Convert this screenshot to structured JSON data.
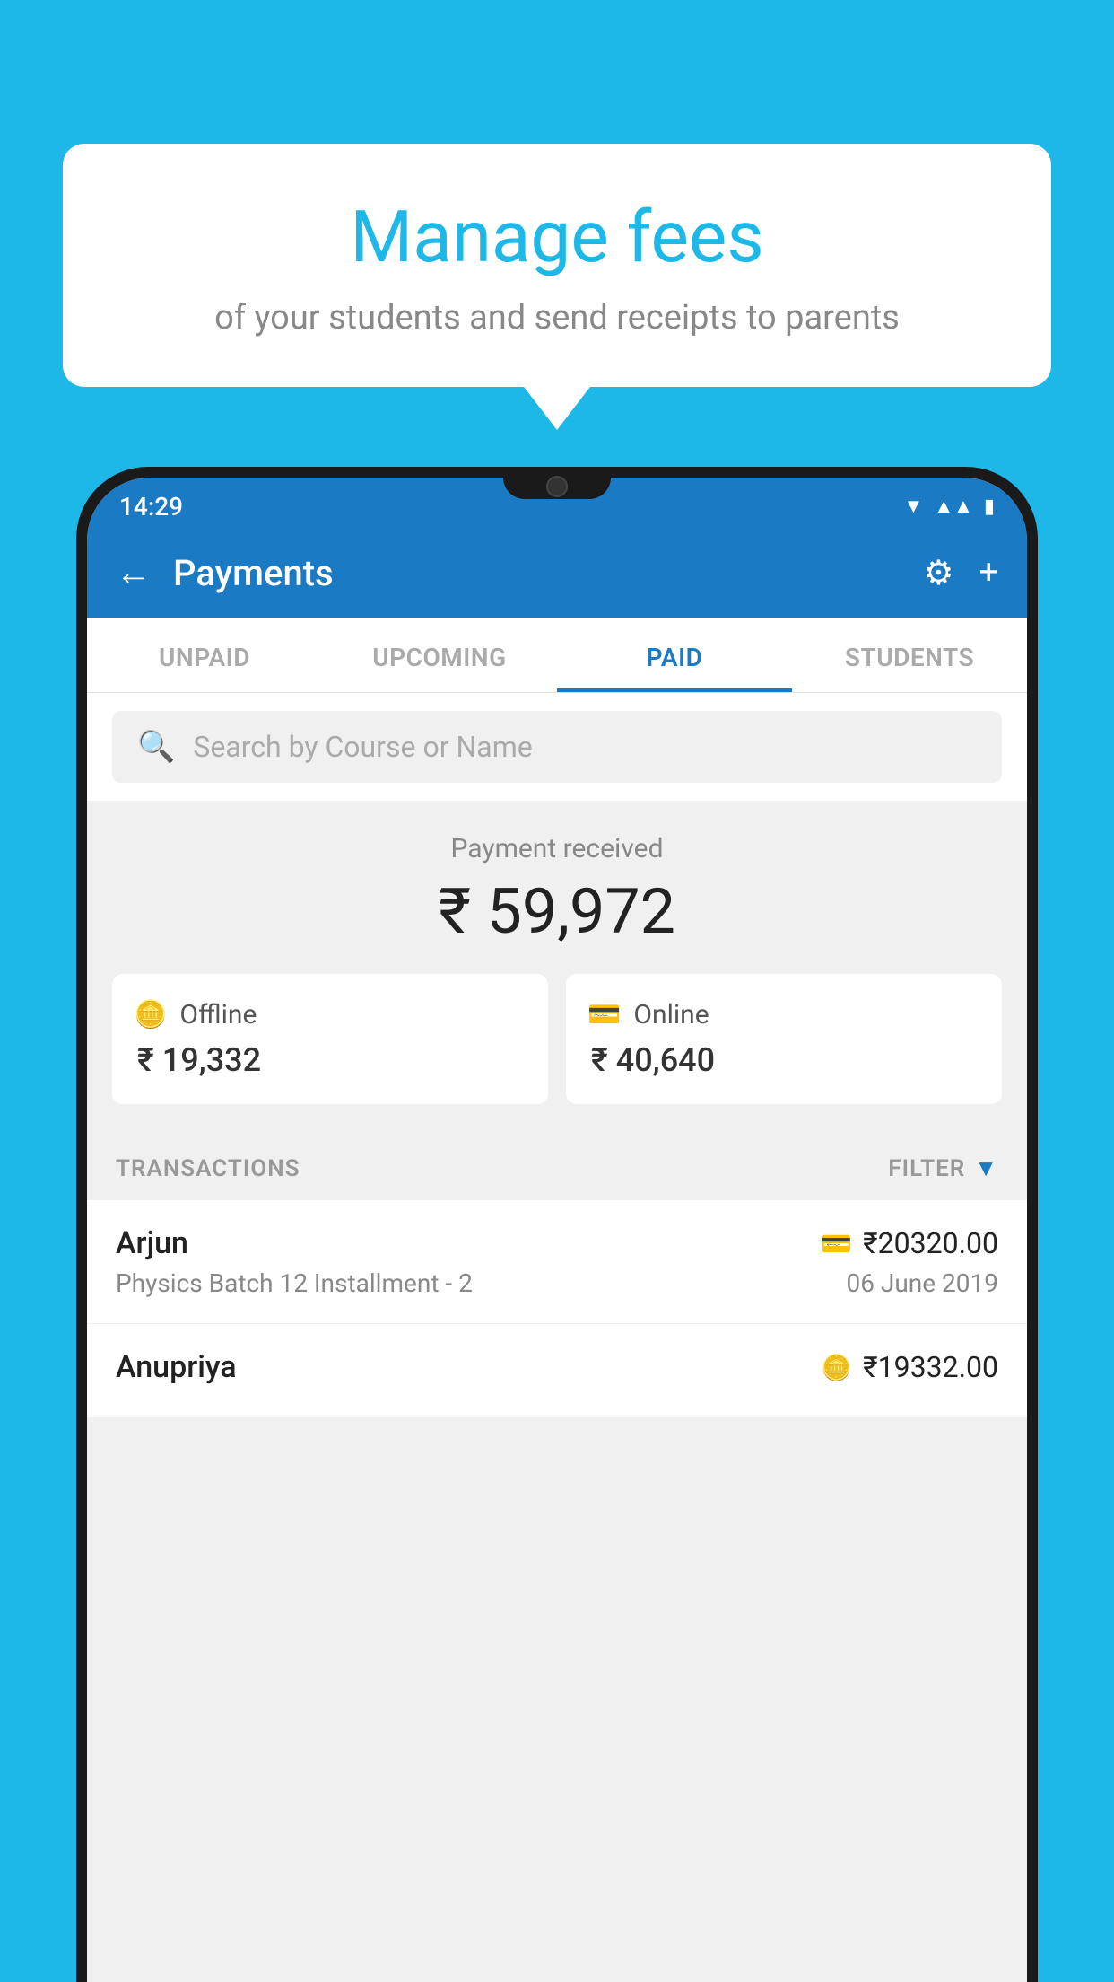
{
  "background_color": "#1db8e8",
  "bubble": {
    "title": "Manage fees",
    "subtitle": "of your students and send receipts to parents"
  },
  "status_bar": {
    "time": "14:29",
    "wifi_icon": "▼",
    "signal_icon": "▲",
    "battery_icon": "▮"
  },
  "app_bar": {
    "back_label": "←",
    "title": "Payments",
    "gear_icon": "⚙",
    "plus_icon": "+"
  },
  "tabs": [
    {
      "label": "UNPAID",
      "active": false
    },
    {
      "label": "UPCOMING",
      "active": false
    },
    {
      "label": "PAID",
      "active": true
    },
    {
      "label": "STUDENTS",
      "active": false
    }
  ],
  "search": {
    "placeholder": "Search by Course or Name"
  },
  "payment_summary": {
    "label": "Payment received",
    "amount": "₹ 59,972",
    "offline_label": "Offline",
    "offline_amount": "₹ 19,332",
    "online_label": "Online",
    "online_amount": "₹ 40,640"
  },
  "transactions": {
    "label": "TRANSACTIONS",
    "filter_label": "FILTER"
  },
  "transaction_items": [
    {
      "name": "Arjun",
      "amount": "₹20320.00",
      "description": "Physics Batch 12 Installment - 2",
      "date": "06 June 2019",
      "icon_type": "card"
    },
    {
      "name": "Anupriya",
      "amount": "₹19332.00",
      "description": "",
      "date": "",
      "icon_type": "cash"
    }
  ]
}
